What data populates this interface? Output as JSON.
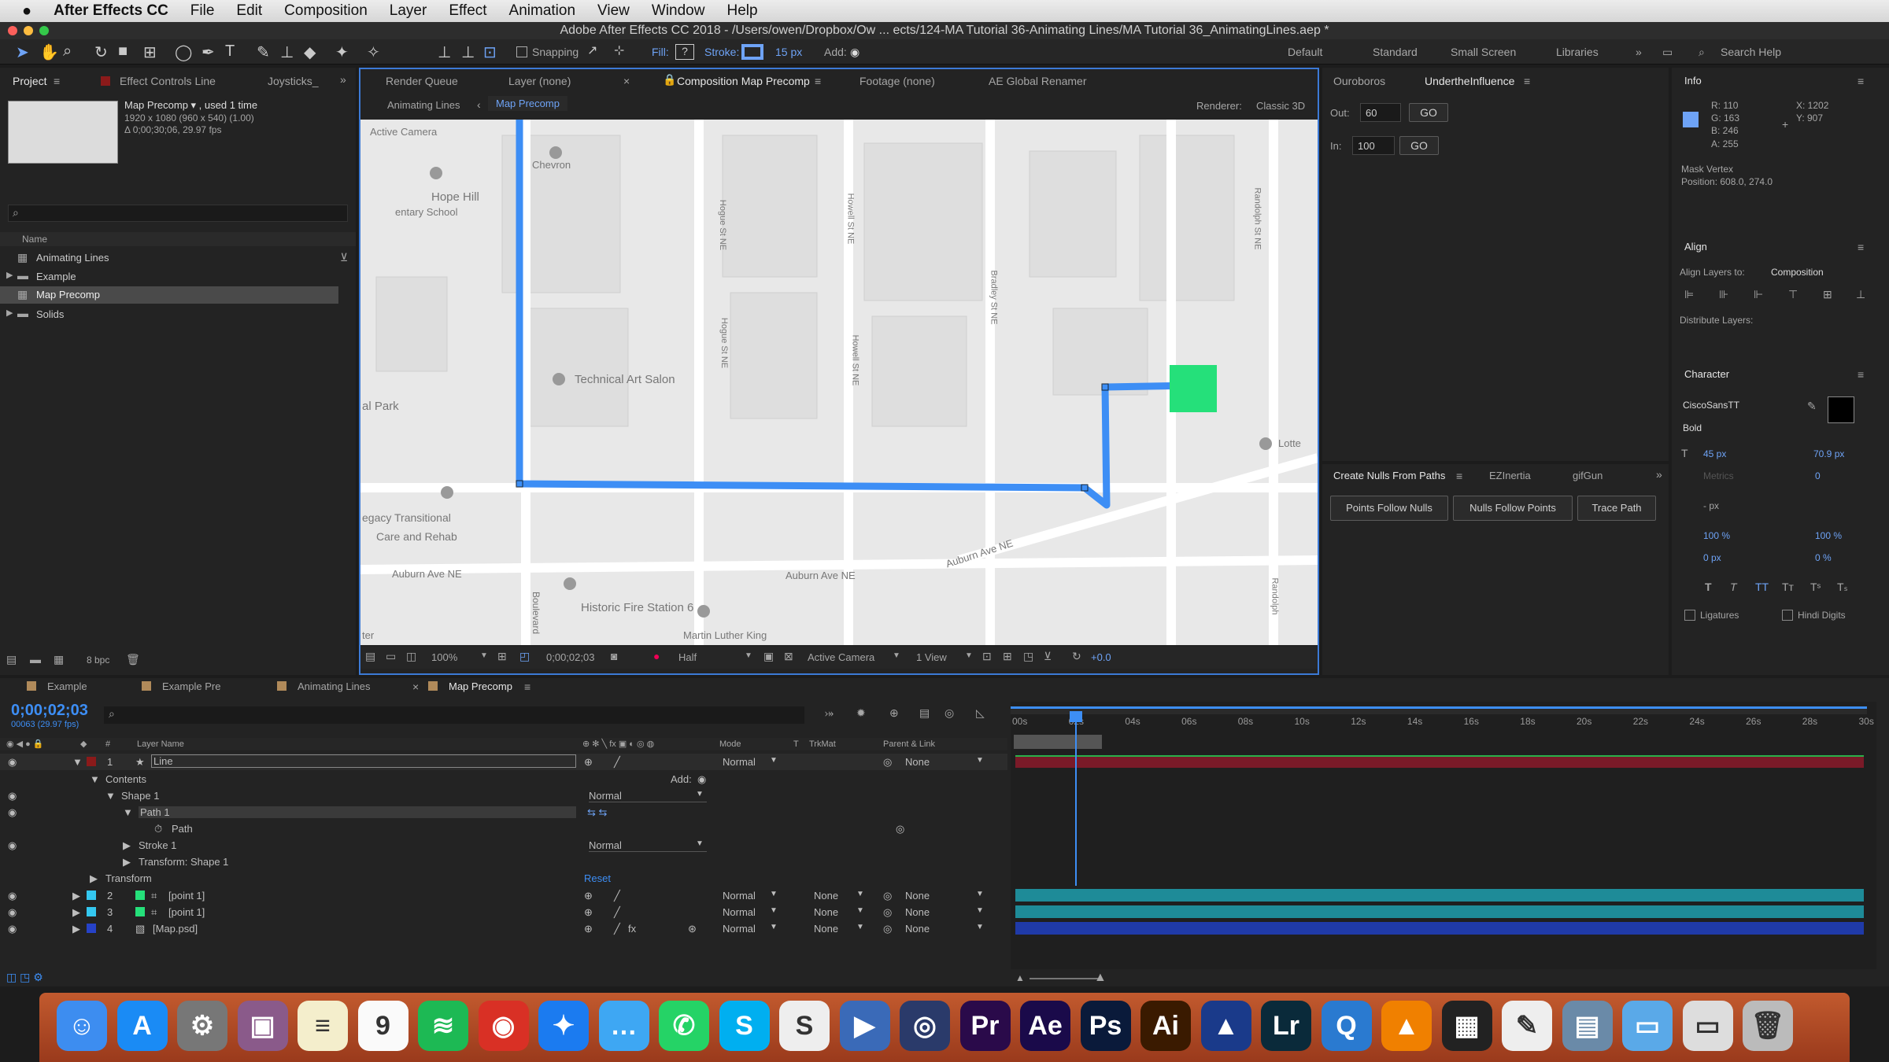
{
  "menu": {
    "apple": "",
    "app": "After Effects CC",
    "items": [
      "File",
      "Edit",
      "Composition",
      "Layer",
      "Effect",
      "Animation",
      "View",
      "Window",
      "Help"
    ]
  },
  "window_title": "Adobe After Effects CC 2018 - /Users/owen/Dropbox/Ow ... ects/124-MA Tutorial 36-Animating Lines/MA Tutorial 36_AnimatingLines.aep *",
  "toolbar": {
    "snapping": "Snapping",
    "fill": "Fill:",
    "stroke": "Stroke:",
    "stroke_px": "15 px",
    "add": "Add:",
    "workspaces": [
      "Default",
      "Standard",
      "Small Screen",
      "Libraries"
    ],
    "search": "Search Help"
  },
  "project": {
    "tabs": [
      "Project",
      "Effect Controls Line",
      "Joysticks_"
    ],
    "item_name": "Map Precomp ▾ , used 1 time",
    "item_size": "1920 x 1080  (960 x 540) (1.00)",
    "item_duration": "Δ 0;00;30;06, 29.97 fps",
    "name_header": "Name",
    "items": [
      "Animating Lines",
      "Example",
      "Map Precomp",
      "Solids"
    ],
    "bpc": "8 bpc"
  },
  "comp": {
    "tabs": [
      "Render Queue",
      "Layer (none)",
      "Composition Map Precomp",
      "Footage (none)",
      "AE Global Renamer"
    ],
    "breadcrumbs": [
      "Animating Lines",
      "Map Precomp"
    ],
    "renderer_label": "Renderer:",
    "renderer": "Classic 3D",
    "active_camera_label": "Active Camera",
    "footer": {
      "zoom": "100%",
      "time": "0;00;02;03",
      "resolution": "Half",
      "camera": "Active Camera",
      "view": "1 View",
      "exposure": "+0.0"
    }
  },
  "map": {
    "labels": [
      "Chevron",
      "Hope Hill",
      "entary School",
      "Technical Art Salon",
      "al Park",
      "egacy Transitional",
      "Care and Rehab",
      "Historic Fire Station 6",
      "Martin Luther King",
      "Auburn Ave NE",
      "Auburn Ave NE",
      "Auburn Ave NE",
      "Boulevard",
      "Hogue St NE",
      "Hogue St NE",
      "Howell St NE",
      "Howell St NE",
      "Bradley St NE",
      "Randolph St NE",
      "Randolph",
      "Lotte",
      "ter"
    ]
  },
  "ouroboros": {
    "tabs": [
      "Ouroboros",
      "UndertheInfluence"
    ],
    "out_label": "Out:",
    "out_val": "60",
    "in_label": "In:",
    "in_val": "100",
    "go": "GO"
  },
  "nulls": {
    "tabs": [
      "Create Nulls From Paths",
      "EZInertia",
      "gifGun"
    ],
    "buttons": [
      "Points Follow Nulls",
      "Nulls Follow Points",
      "Trace Path"
    ]
  },
  "info": {
    "title": "Info",
    "r": "R: 110",
    "g": "G: 163",
    "b": "B: 246",
    "a": "A: 255",
    "x": "X: 1202",
    "y": "Y: 907",
    "mask": "Mask Vertex",
    "position": "Position: 608.0, 274.0",
    "swatch": "#6ea3f6"
  },
  "align": {
    "title": "Align",
    "to_label": "Align Layers to:",
    "to_val": "Composition",
    "dist": "Distribute Layers:"
  },
  "character": {
    "title": "Character",
    "font": "CiscoSansTT",
    "style": "Bold",
    "size": "45 px",
    "leading": "70.9 px",
    "metrics": "Metrics",
    "tracking": "0",
    "stroke": "- px",
    "vscale": "100 %",
    "hscale": "100 %",
    "baseline": "0 px",
    "tsume": "0 %",
    "ligatures": "Ligatures",
    "hindi": "Hindi Digits"
  },
  "timeline": {
    "tabs": [
      "Example",
      "Example Pre",
      "Animating Lines",
      "Map Precomp"
    ],
    "time": "0;00;02;03",
    "frames": "00063 (29.97 fps)",
    "cols": {
      "num": "#",
      "layer": "Layer Name",
      "mode": "Mode",
      "t": "T",
      "trkmat": "TrkMat",
      "parent": "Parent & Link"
    },
    "ruler": [
      "00s",
      "02s",
      "04s",
      "06s",
      "08s",
      "10s",
      "12s",
      "14s",
      "16s",
      "18s",
      "20s",
      "22s",
      "24s",
      "26s",
      "28s",
      "30s"
    ],
    "rows": [
      {
        "num": "1",
        "name": "Line",
        "mode": "Normal",
        "trk": "",
        "parent": "None",
        "color": "#8b1a1a"
      },
      {
        "num": "",
        "name": "Contents",
        "add": "Add:"
      },
      {
        "num": "",
        "name": "Shape 1",
        "mode": "Normal"
      },
      {
        "num": "",
        "name": "Path 1"
      },
      {
        "num": "",
        "name": "Path"
      },
      {
        "num": "",
        "name": "Stroke 1",
        "mode": "Normal"
      },
      {
        "num": "",
        "name": "Transform: Shape 1"
      },
      {
        "num": "",
        "name": "Transform",
        "reset": "Reset"
      },
      {
        "num": "2",
        "name": "[point 1]",
        "mode": "Normal",
        "trk": "None",
        "parent": "None",
        "color": "#34c8f0"
      },
      {
        "num": "3",
        "name": "[point 1]",
        "mode": "Normal",
        "trk": "None",
        "parent": "None",
        "color": "#34c8f0"
      },
      {
        "num": "4",
        "name": "[Map.psd]",
        "mode": "Normal",
        "trk": "None",
        "parent": "None",
        "color": "#2642c8"
      }
    ]
  },
  "dock": [
    {
      "name": "finder",
      "label": "☺",
      "bg": "#3d8df0"
    },
    {
      "name": "app-store",
      "label": "A",
      "bg": "#1a8bf5"
    },
    {
      "name": "system-preferences",
      "label": "⚙",
      "bg": "#777"
    },
    {
      "name": "preview",
      "label": "▣",
      "bg": "#8a5a8a"
    },
    {
      "name": "notes",
      "label": "≡",
      "bg": "#f4eecc"
    },
    {
      "name": "calendar",
      "label": "9",
      "bg": "#fafafa"
    },
    {
      "name": "spotify",
      "label": "≋",
      "bg": "#1db954"
    },
    {
      "name": "chrome",
      "label": "◉",
      "bg": "#d93025"
    },
    {
      "name": "safari",
      "label": "✦",
      "bg": "#1b7bf0"
    },
    {
      "name": "messages",
      "label": "…",
      "bg": "#3ea7f3"
    },
    {
      "name": "whatsapp",
      "label": "✆",
      "bg": "#25d366"
    },
    {
      "name": "skype",
      "label": "S",
      "bg": "#00aff0"
    },
    {
      "name": "slides",
      "label": "S",
      "bg": "#eee"
    },
    {
      "name": "claquette",
      "label": "▶",
      "bg": "#3a6ab8"
    },
    {
      "name": "cinema4d",
      "label": "◎",
      "bg": "#2a3a6a"
    },
    {
      "name": "premiere",
      "label": "Pr",
      "bg": "#2a0a4a"
    },
    {
      "name": "after-effects",
      "label": "Ae",
      "bg": "#1a0a4a"
    },
    {
      "name": "photoshop",
      "label": "Ps",
      "bg": "#0a1a3a"
    },
    {
      "name": "illustrator",
      "label": "Ai",
      "bg": "#3a1a00"
    },
    {
      "name": "affinity",
      "label": "▲",
      "bg": "#1a3a8a"
    },
    {
      "name": "lightroom",
      "label": "Lr",
      "bg": "#0a2a3a"
    },
    {
      "name": "quicktime",
      "label": "Q",
      "bg": "#2a7ad0"
    },
    {
      "name": "vlc",
      "label": "▲",
      "bg": "#f08000"
    },
    {
      "name": "clapper",
      "label": "▦",
      "bg": "#222"
    },
    {
      "name": "textedit",
      "label": "✎",
      "bg": "#eee"
    },
    {
      "name": "image-viewer",
      "label": "▤",
      "bg": "#6a8aa8"
    },
    {
      "name": "folder",
      "label": "▭",
      "bg": "#5aa9e8"
    },
    {
      "name": "doc-chrome",
      "label": "▭",
      "bg": "#ddd"
    },
    {
      "name": "trash",
      "label": "🗑",
      "bg": "#bbb"
    }
  ]
}
